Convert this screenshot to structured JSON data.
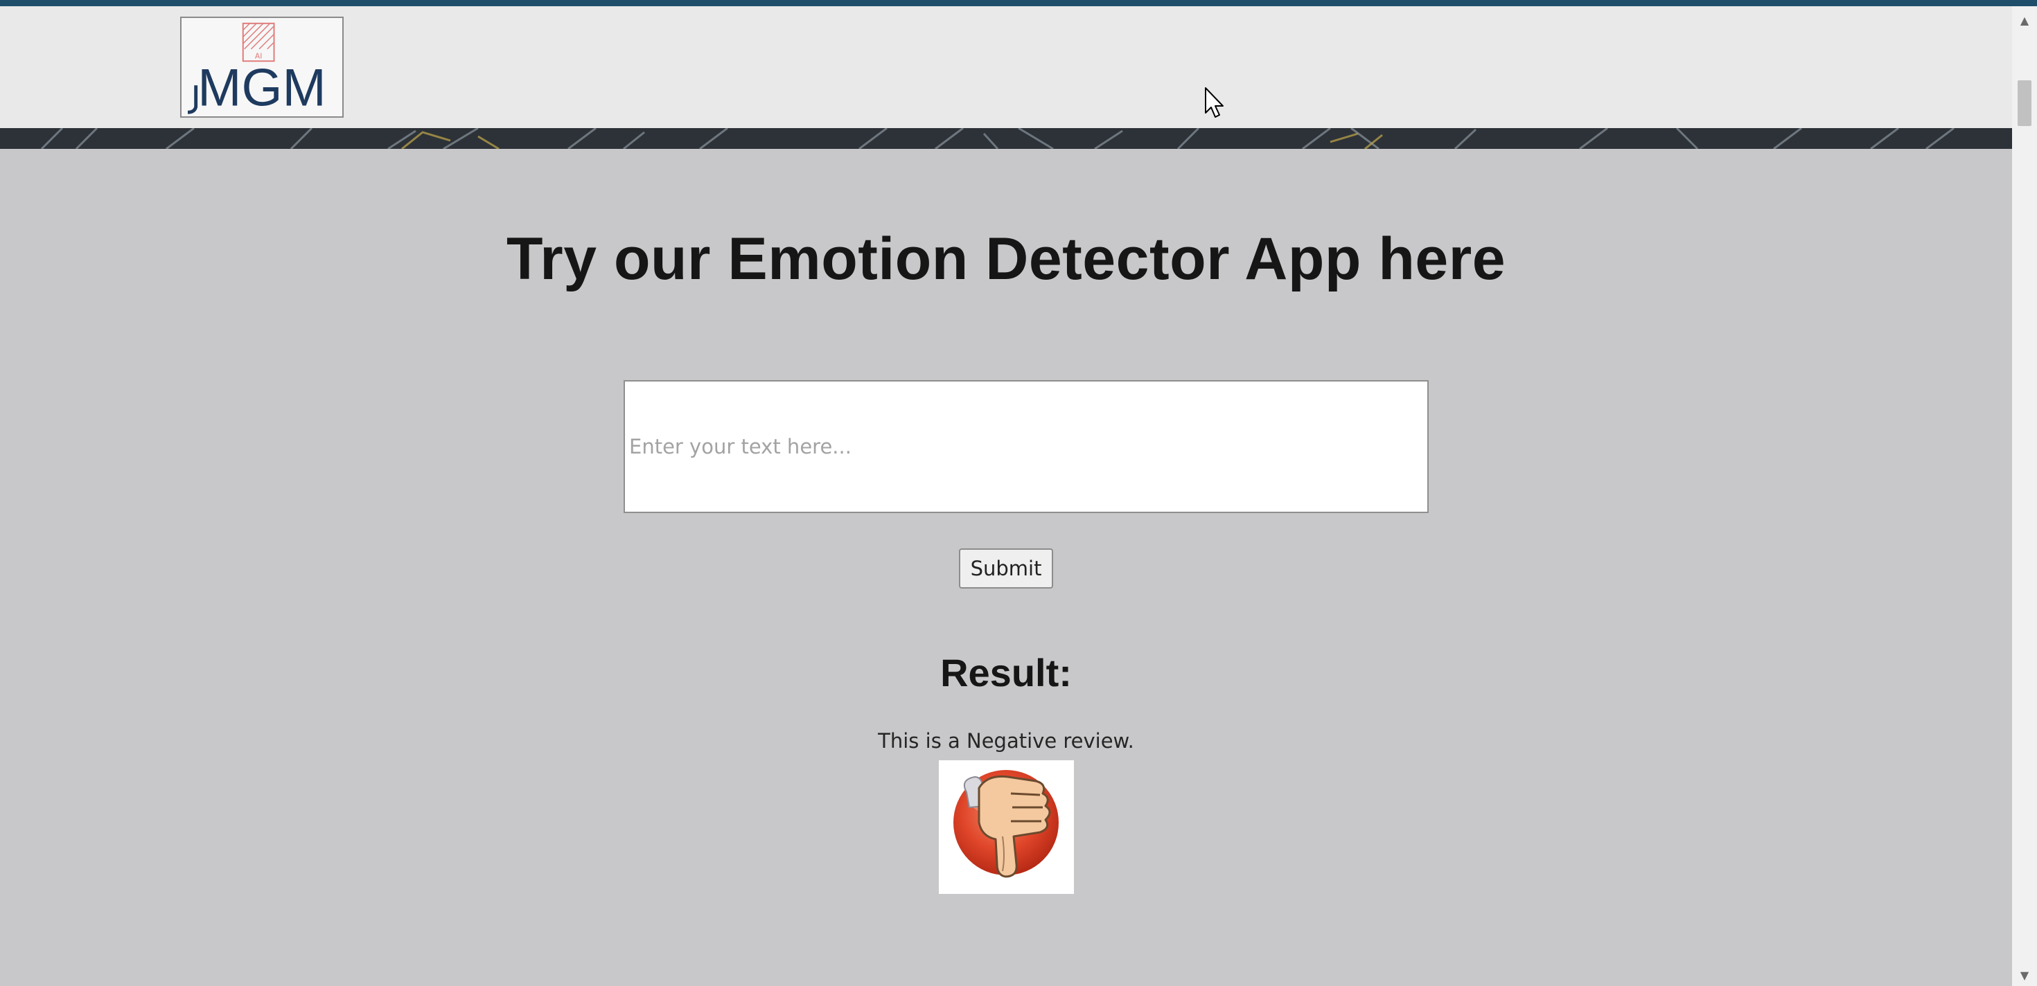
{
  "logo": {
    "text": "MGM",
    "badge": "AI"
  },
  "main": {
    "title": "Try our Emotion Detector App here",
    "input": {
      "placeholder": "Enter your text here...",
      "value": ""
    },
    "submit_label": "Submit",
    "result_heading": "Result:",
    "result_text": "This is a Negative review.",
    "result_icon": "thumbs-down-icon"
  },
  "colors": {
    "top_strip": "#1f4e6b",
    "header_bg": "#e9e9e9",
    "page_bg": "#c8c8ca",
    "logo_navy": "#1e3a5f",
    "logo_accent": "#e07a7a",
    "thumb_circle": "#e0462a"
  }
}
